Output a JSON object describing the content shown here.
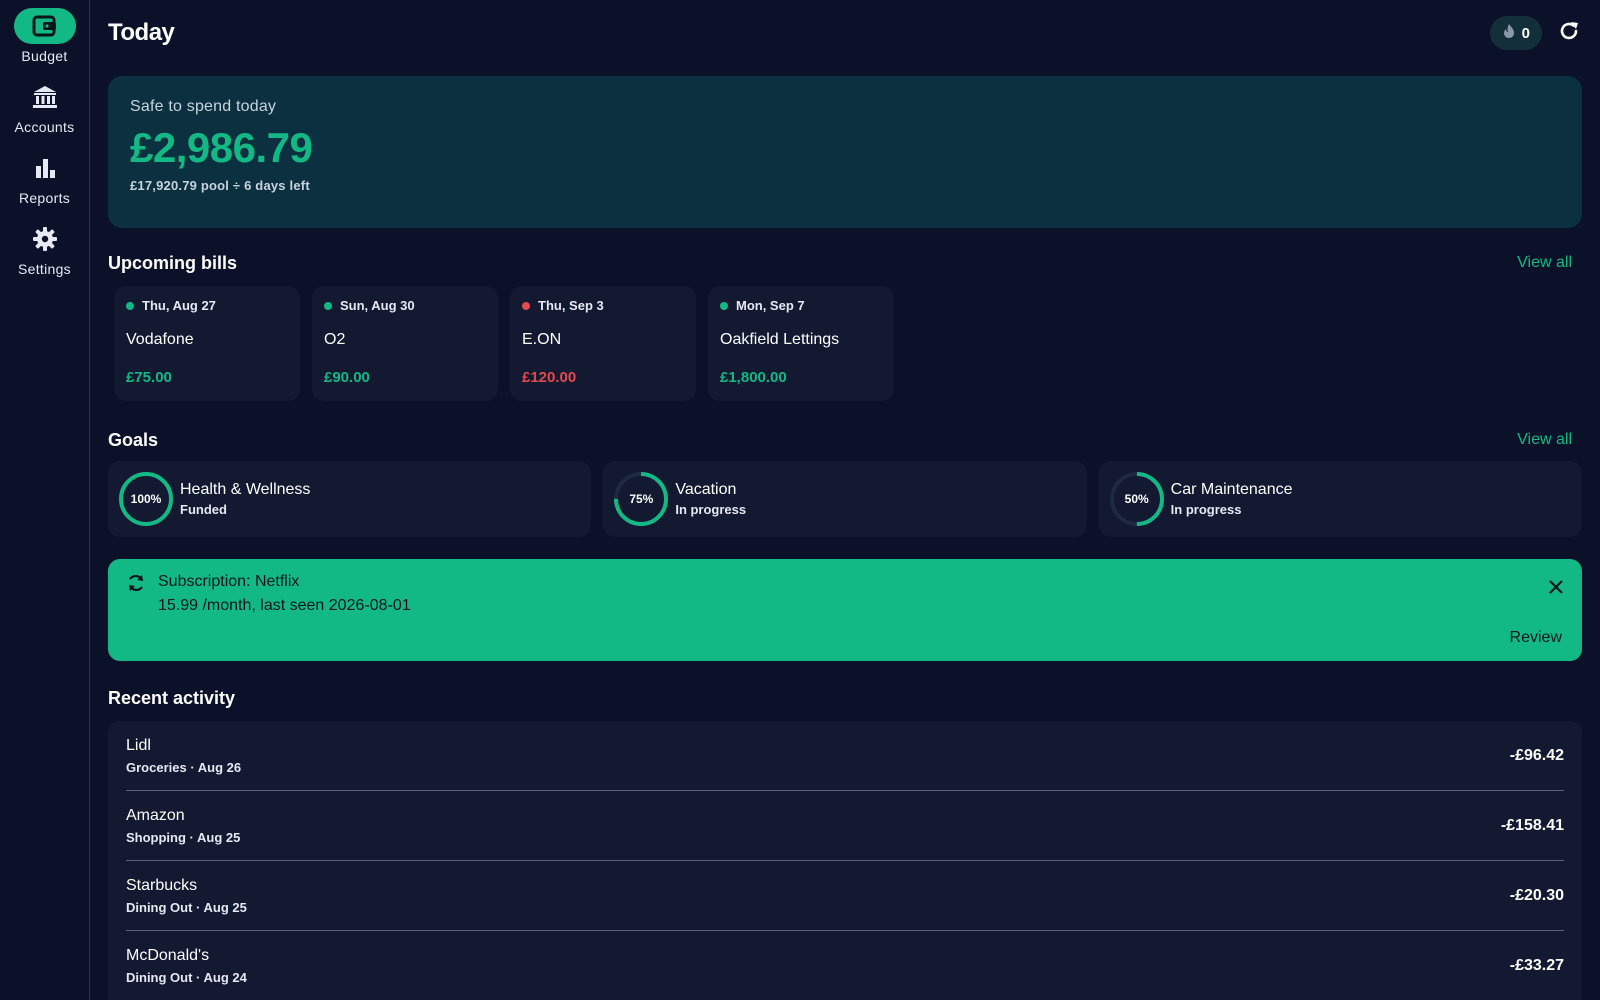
{
  "sidebar": {
    "items": [
      {
        "label": "Budget",
        "icon": "wallet-icon",
        "active": true
      },
      {
        "label": "Accounts",
        "icon": "bank-icon",
        "active": false
      },
      {
        "label": "Reports",
        "icon": "bar-chart-icon",
        "active": false
      },
      {
        "label": "Settings",
        "icon": "gear-icon",
        "active": false
      }
    ]
  },
  "header": {
    "title": "Today",
    "streak_count": "0",
    "streak_icon": "flame-icon",
    "refresh_icon": "refresh-icon"
  },
  "safe_to_spend": {
    "label": "Safe to spend today",
    "amount": "£2,986.79",
    "detail": "£17,920.79 pool ÷ 6 days left"
  },
  "bills": {
    "title": "Upcoming bills",
    "view_all": "View all",
    "items": [
      {
        "date": "Thu, Aug 27",
        "name": "Vodafone",
        "amount": "£75.00",
        "status_color": "#13b984"
      },
      {
        "date": "Sun, Aug 30",
        "name": "O2",
        "amount": "£90.00",
        "status_color": "#13b984"
      },
      {
        "date": "Thu, Sep 3",
        "name": "E.ON",
        "amount": "£120.00",
        "status_color": "#e5484d"
      },
      {
        "date": "Mon, Sep 7",
        "name": "Oakfield Lettings",
        "amount": "£1,800.00",
        "status_color": "#13b984"
      }
    ]
  },
  "goals": {
    "title": "Goals",
    "view_all": "View all",
    "items": [
      {
        "name": "Health & Wellness",
        "status": "Funded",
        "percent_label": "100%",
        "progress": 1.0
      },
      {
        "name": "Vacation",
        "status": "In progress",
        "percent_label": "75%",
        "progress": 0.75
      },
      {
        "name": "Car Maintenance",
        "status": "In progress",
        "percent_label": "50%",
        "progress": 0.5
      }
    ]
  },
  "subscription": {
    "title": "Subscription: Netflix",
    "detail": "15.99 /month, last seen 2026-08-01",
    "review": "Review",
    "icon": "recurring-icon",
    "close_icon": "close-icon"
  },
  "recent": {
    "title": "Recent activity",
    "items": [
      {
        "name": "Lidl",
        "meta": "Groceries · Aug 26",
        "amount": "-£96.42"
      },
      {
        "name": "Amazon",
        "meta": "Shopping · Aug 25",
        "amount": "-£158.41"
      },
      {
        "name": "Starbucks",
        "meta": "Dining Out · Aug 25",
        "amount": "-£20.30"
      },
      {
        "name": "McDonald's",
        "meta": "Dining Out · Aug 24",
        "amount": "-£33.27"
      }
    ]
  },
  "colors": {
    "accent": "#13b984",
    "danger": "#e5484d",
    "background": "#0b1128",
    "card": "#121931",
    "hero": "#0b3140"
  }
}
